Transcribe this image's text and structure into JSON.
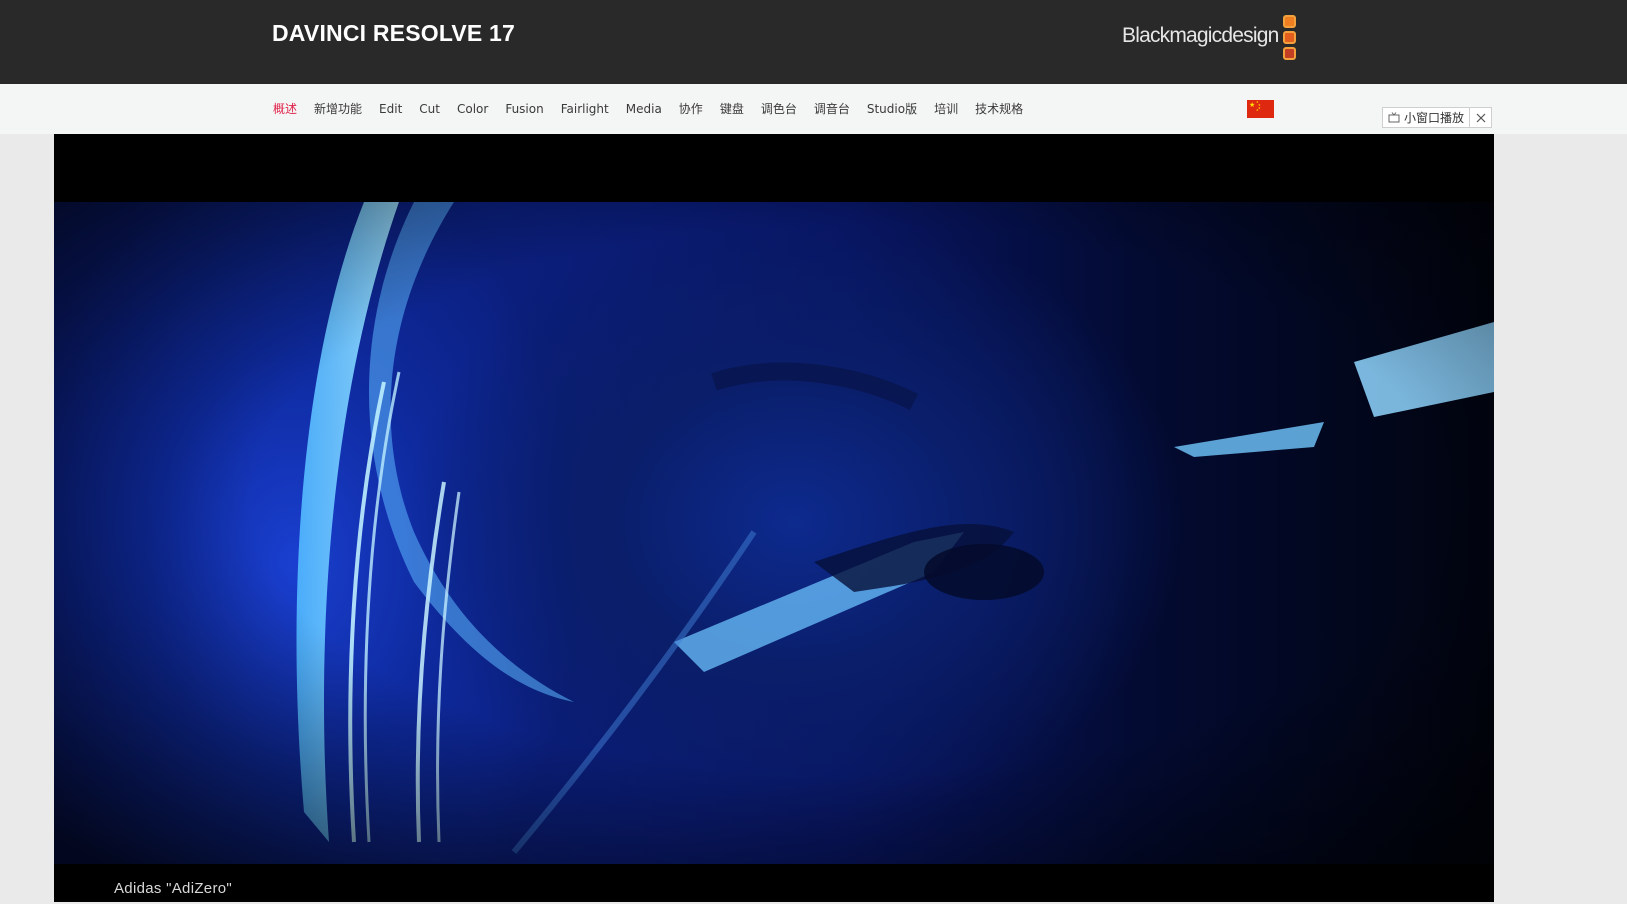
{
  "header": {
    "product_title": "DAVINCI RESOLVE 17",
    "brand_name": "Blackmagicdesign",
    "brand_colors": [
      "#f07f21",
      "#e45e1e",
      "#c23f23"
    ]
  },
  "nav": {
    "items": [
      {
        "label": "概述",
        "active": true
      },
      {
        "label": "新增功能",
        "active": false
      },
      {
        "label": "Edit",
        "active": false
      },
      {
        "label": "Cut",
        "active": false
      },
      {
        "label": "Color",
        "active": false
      },
      {
        "label": "Fusion",
        "active": false
      },
      {
        "label": "Fairlight",
        "active": false
      },
      {
        "label": "Media",
        "active": false
      },
      {
        "label": "协作",
        "active": false
      },
      {
        "label": "键盘",
        "active": false
      },
      {
        "label": "调色台",
        "active": false
      },
      {
        "label": "调音台",
        "active": false
      },
      {
        "label": "Studio版",
        "active": false
      },
      {
        "label": "培训",
        "active": false
      },
      {
        "label": "技术规格",
        "active": false
      }
    ],
    "active_color": "#e0224a",
    "region_flag": "china-flag-icon"
  },
  "mini_player": {
    "label": "小窗口播放",
    "icon": "tv-icon",
    "close_icon": "close-icon"
  },
  "video": {
    "caption": "Adidas \"AdiZero\""
  }
}
